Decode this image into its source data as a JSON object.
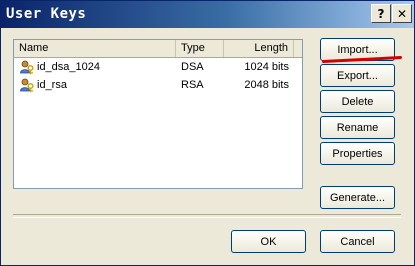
{
  "window": {
    "title": "User Keys"
  },
  "titlebar": {
    "help_glyph": "?",
    "close_glyph": "✕"
  },
  "list": {
    "columns": [
      "Name",
      "Type",
      "Length"
    ],
    "rows": [
      {
        "icon": "key-user-icon",
        "name": "id_dsa_1024",
        "type": "DSA",
        "length": "1024 bits"
      },
      {
        "icon": "key-user-icon",
        "name": "id_rsa",
        "type": "RSA",
        "length": "2048 bits"
      }
    ]
  },
  "buttons": {
    "import": "Import...",
    "export": "Export...",
    "delete": "Delete",
    "rename": "Rename",
    "properties": "Properties",
    "generate": "Generate...",
    "ok": "OK",
    "cancel": "Cancel"
  },
  "colors": {
    "title_bar": "#0a246a",
    "annotation_line": "#d40000",
    "dialog_bg": "#ece9d8"
  }
}
